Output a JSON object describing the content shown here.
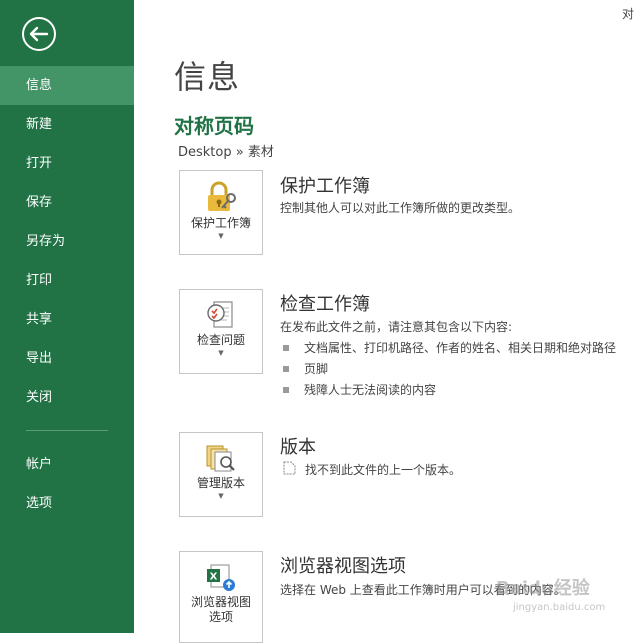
{
  "window": {
    "title_fragment": "对"
  },
  "sidebar": {
    "back_icon": "back-arrow-icon",
    "items": [
      {
        "label": "信息",
        "active": true
      },
      {
        "label": "新建"
      },
      {
        "label": "打开"
      },
      {
        "label": "保存"
      },
      {
        "label": "另存为"
      },
      {
        "label": "打印"
      },
      {
        "label": "共享"
      },
      {
        "label": "导出"
      },
      {
        "label": "关闭"
      }
    ],
    "bottom_items": [
      {
        "label": "帐户"
      },
      {
        "label": "选项"
      }
    ],
    "colors": {
      "background": "#217346",
      "active": "#439467"
    }
  },
  "main": {
    "title": "信息",
    "document_name": "对称页码",
    "path": "Desktop » 素材",
    "sections": [
      {
        "tile_label": "保护工作簿",
        "tile_icon": "lock-key-icon",
        "title": "保护工作簿",
        "description": "控制其他人可以对此工作簿所做的更改类型。"
      },
      {
        "tile_label": "检查问题",
        "tile_icon": "inspect-document-icon",
        "title": "检查工作簿",
        "description": "在发布此文件之前，请注意其包含以下内容:",
        "bullets": [
          "文档属性、打印机路径、作者的姓名、相关日期和绝对路径",
          "页脚",
          "残障人士无法阅读的内容"
        ]
      },
      {
        "tile_label": "管理版本",
        "tile_icon": "manage-versions-icon",
        "title": "版本",
        "description_icon": "version-file-icon",
        "description": "找不到此文件的上一个版本。"
      },
      {
        "tile_label": "浏览器视图选项",
        "tile_icon": "excel-browser-view-icon",
        "title": "浏览器视图选项",
        "description": "选择在 Web 上查看此工作簿时用户可以看到的内容。"
      }
    ]
  },
  "watermark": {
    "text": "Baidu经验",
    "sub": "jingyan.baidu.com"
  },
  "colors": {
    "accent": "#217346",
    "text": "#444444",
    "border": "#c6c6c6"
  }
}
